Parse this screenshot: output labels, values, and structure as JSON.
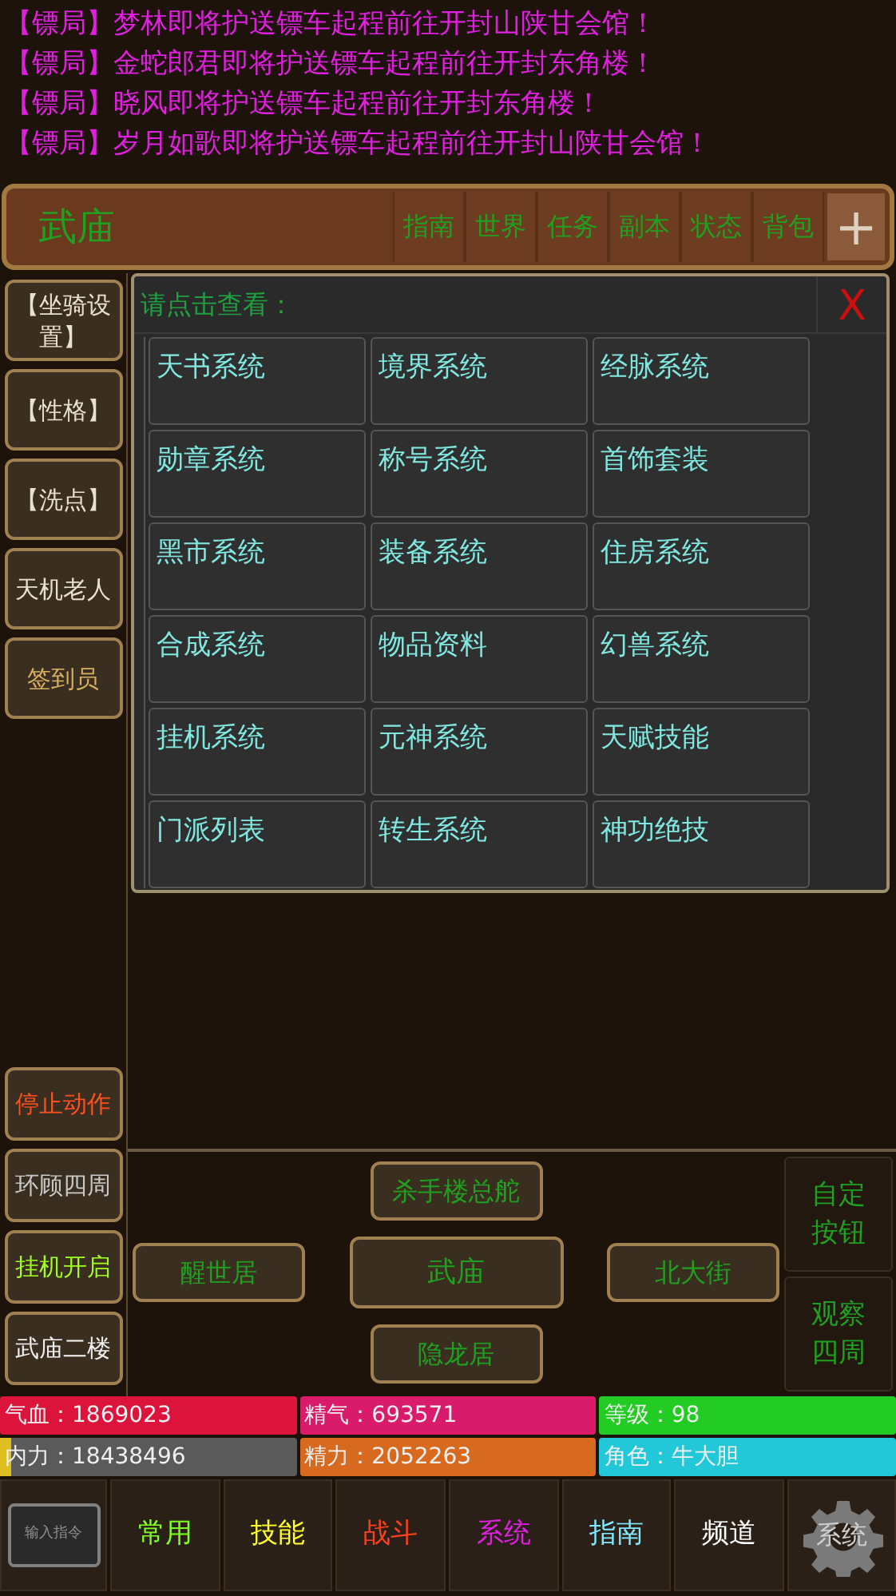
{
  "messages": [
    "【镖局】梦林即将护送镖车起程前往开封山陕甘会馆！",
    "【镖局】金蛇郎君即将护送镖车起程前往开封东角楼！",
    "【镖局】晓风即将护送镖车起程前往开封东角楼！",
    "【镖局】岁月如歌即将护送镖车起程前往开封山陕甘会馆！"
  ],
  "location": {
    "title": "武庙",
    "tabs": [
      "指南",
      "世界",
      "任务",
      "副本",
      "状态",
      "背包"
    ],
    "plus": "+"
  },
  "side_top": [
    {
      "label": "【坐骑设置】",
      "color": "#e8e0d0"
    },
    {
      "label": "【性格】",
      "color": "#e8e0d0"
    },
    {
      "label": "【洗点】",
      "color": "#e8e0d0"
    },
    {
      "label": "天机老人",
      "color": "#e8e0d0"
    },
    {
      "label": "签到员",
      "color": "#d8b060"
    }
  ],
  "side_bottom": [
    {
      "label": "停止动作",
      "color": "#ff5020"
    },
    {
      "label": "环顾四周",
      "color": "#c8c8c8"
    },
    {
      "label": "挂机开启",
      "color": "#a0ff20"
    },
    {
      "label": "武庙二楼",
      "color": "#f0f0f0"
    }
  ],
  "dialog": {
    "title": "请点击查看：",
    "close": "X",
    "items": [
      "天书系统",
      "境界系统",
      "经脉系统",
      "勋章系统",
      "称号系统",
      "首饰套装",
      "黑市系统",
      "装备系统",
      "住房系统",
      "合成系统",
      "物品资料",
      "幻兽系统",
      "挂机系统",
      "元神系统",
      "天赋技能",
      "门派列表",
      "转生系统",
      "神功绝技"
    ]
  },
  "map": {
    "north": "杀手楼总舵",
    "west": "醒世居",
    "center": "武庙",
    "east": "北大街",
    "south": "隐龙居"
  },
  "right_buttons": [
    "自定按钮",
    "观察四周"
  ],
  "stats": [
    {
      "text": "气血：1869023",
      "color": "#dc143c"
    },
    {
      "text": "精气：693571",
      "color": "#d81b6a"
    },
    {
      "text": "等级：98",
      "color": "#22cc22"
    },
    {
      "text": "内力：18438496",
      "color": "#5a5a5a",
      "level": 0.04
    },
    {
      "text": "精力：2052263",
      "color": "#d86a20"
    },
    {
      "text": "角色：牛大胆",
      "color": "#22c8d8"
    }
  ],
  "input_button": "输入指令",
  "nav": [
    {
      "label": "常用",
      "color": "#80ff20"
    },
    {
      "label": "技能",
      "color": "#ffff30"
    },
    {
      "label": "战斗",
      "color": "#ff4020"
    },
    {
      "label": "系统",
      "color": "#e020e0"
    },
    {
      "label": "指南",
      "color": "#80e8ff"
    },
    {
      "label": "频道",
      "color": "#ffffff"
    }
  ],
  "system_button": "系统"
}
